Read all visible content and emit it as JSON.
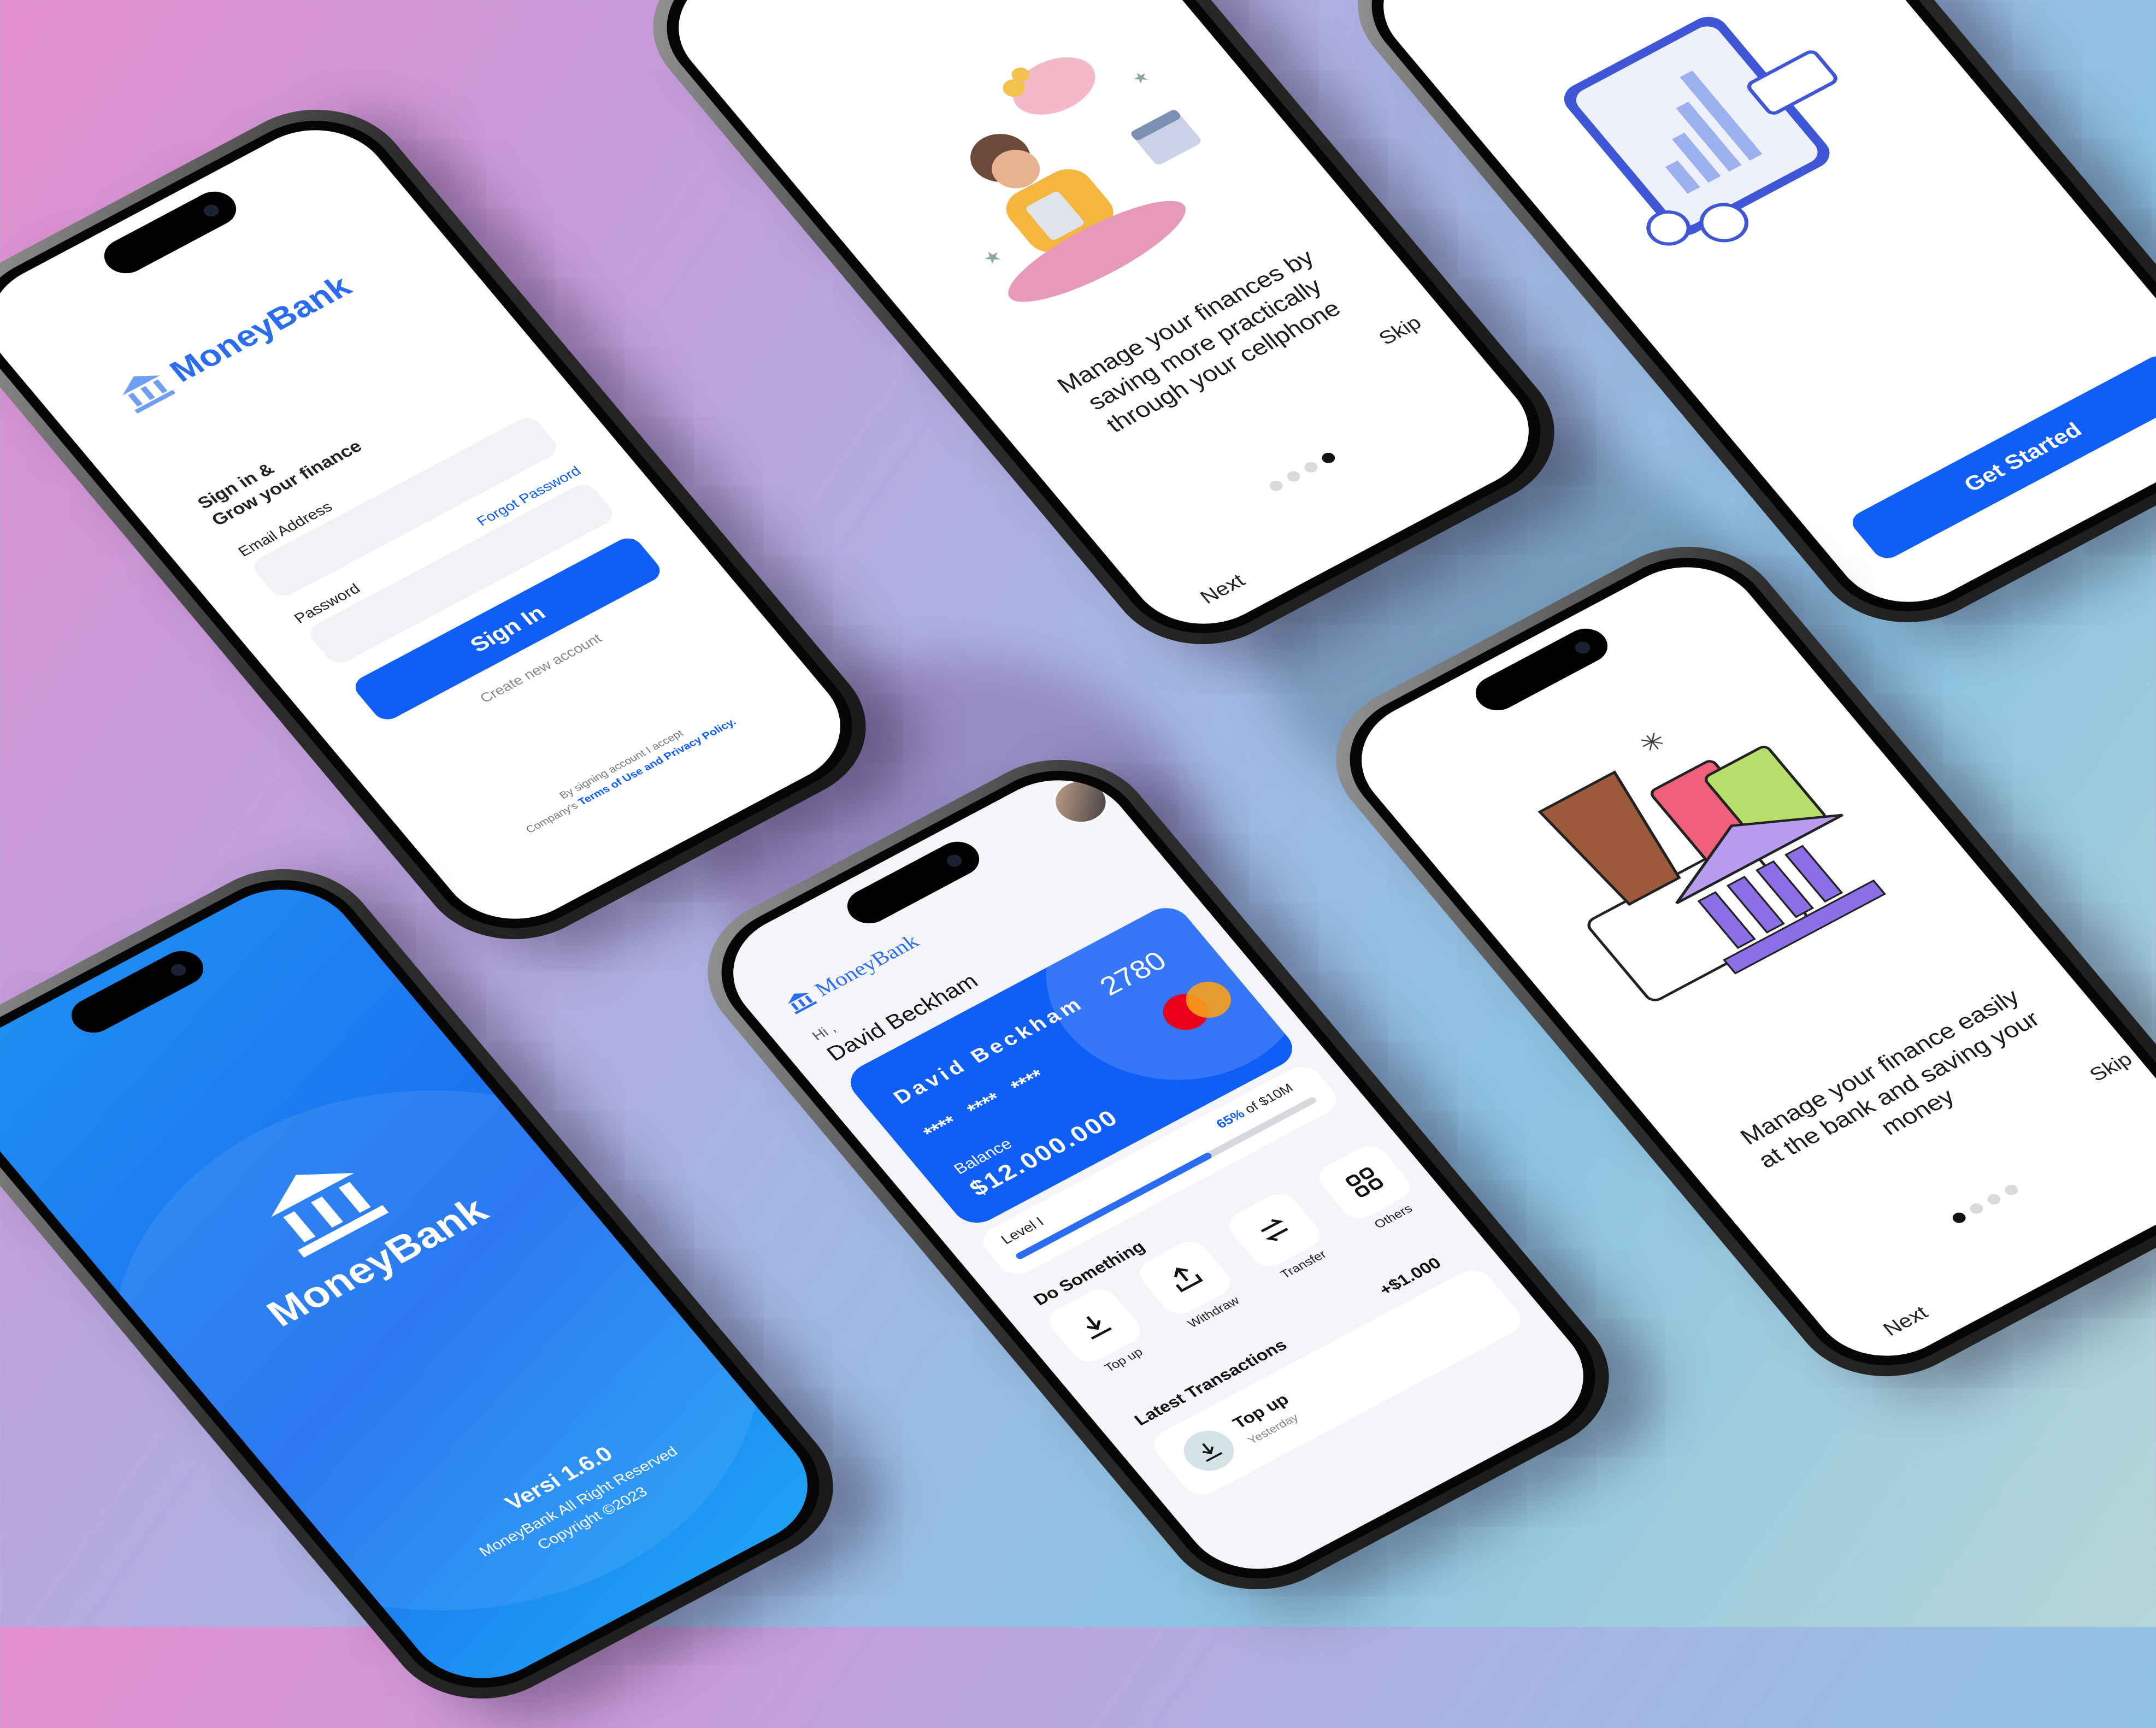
{
  "login": {
    "brand": "MoneyBank",
    "heading_line1": "Sign in &",
    "heading_line2": "Grow your finance",
    "email_label": "Email Address",
    "password_label": "Password",
    "forgot_password": "Forgot Password",
    "sign_in_button": "Sign In",
    "create_account": "Create new account",
    "terms_line1": "By signing account I accept",
    "terms_prefix": "Company's ",
    "terms_link": "Terms of Use and Privacy Policy."
  },
  "onboarding_1": {
    "text": "Manage your finances by saving more practically through your cellphone",
    "skip": "Skip",
    "next": "Next"
  },
  "onboarding_3": {
    "get_started": "Get Started"
  },
  "splash": {
    "brand": "MoneyBank",
    "version": "Versi 1.6.0",
    "rights": "MoneyBank All Right Reserved",
    "copyright": "Copyright ©2023"
  },
  "dashboard": {
    "brand": "MoneyBank",
    "greeting": "Hi ,",
    "user_name": "David Beckham",
    "card": {
      "holder": "David Beckham",
      "masked_1": "****",
      "masked_2": "****",
      "masked_3": "****",
      "last4": "2780",
      "balance_label": "Balance",
      "balance": "$12.000.000"
    },
    "level": {
      "label": "Level I",
      "percent_text": "65%",
      "of_text": " of $10M",
      "progress": 0.65
    },
    "actions_title": "Do Something",
    "actions": [
      {
        "label": "Top up",
        "icon": "download-icon"
      },
      {
        "label": "Withdraw",
        "icon": "upload-icon"
      },
      {
        "label": "Transfer",
        "icon": "swap-icon"
      },
      {
        "label": "Others",
        "icon": "grid-icon"
      }
    ],
    "transactions_title": "Latest Transactions",
    "transactions_amount": "+$1.000",
    "transaction": {
      "title": "Top up",
      "date": "Yesterday"
    }
  },
  "onboarding_2": {
    "text": "Manage your finance easily at the bank and saving your money",
    "skip": "Skip",
    "next": "Next"
  },
  "colors": {
    "accent": "#0f5ef7",
    "splash_bg": "#1e88ee",
    "card_bg": "#0f5ef7"
  }
}
